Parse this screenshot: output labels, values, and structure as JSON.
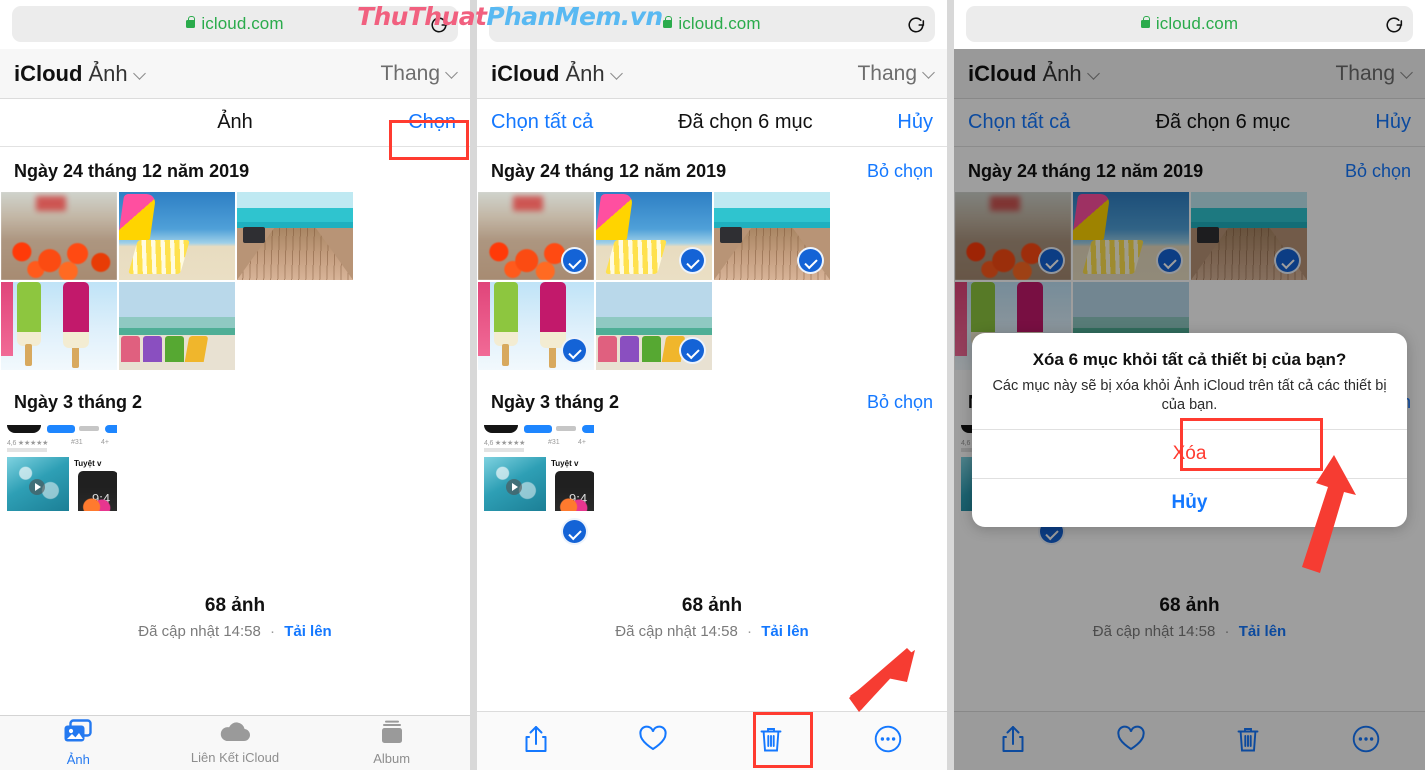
{
  "watermark": {
    "part1": "ThuThuat",
    "part2": "PhanMem.vn"
  },
  "browser": {
    "url": "icloud.com",
    "lock_icon": "lock-icon",
    "reload_icon": "reload-icon"
  },
  "app": {
    "brand_first": "iCloud",
    "brand_second": "Ảnh",
    "scale_label": "Thang"
  },
  "panel1": {
    "action_bar": {
      "center_title": "Ảnh",
      "select_label": "Chọn"
    },
    "sections": [
      {
        "title": "Ngày 24 tháng 12 năm 2019",
        "action": ""
      },
      {
        "title": "Ngày 3 tháng 2",
        "action": ""
      }
    ],
    "footer": {
      "count": "68 ảnh",
      "updated": "Đã cập nhật 14:58",
      "dot": "·",
      "upload": "Tải lên"
    },
    "tabs": [
      {
        "label": "Ảnh",
        "icon": "photos-icon",
        "active": true
      },
      {
        "label": "Liên Kết iCloud",
        "icon": "cloud-icon",
        "active": false
      },
      {
        "label": "Album",
        "icon": "albums-icon",
        "active": false
      }
    ]
  },
  "panel2": {
    "action_bar": {
      "select_all": "Chọn tất cả",
      "selected_count": "Đã chọn 6 mục",
      "cancel": "Hủy"
    },
    "sections": [
      {
        "title": "Ngày 24 tháng 12 năm 2019",
        "action": "Bỏ chọn"
      },
      {
        "title": "Ngày 3 tháng 2",
        "action": "Bỏ chọn"
      }
    ],
    "footer": {
      "count": "68 ảnh",
      "updated": "Đã cập nhật 14:58",
      "dot": "·",
      "upload": "Tải lên"
    },
    "toolbar": [
      {
        "name": "share-icon"
      },
      {
        "name": "heart-icon"
      },
      {
        "name": "trash-icon"
      },
      {
        "name": "more-icon"
      }
    ]
  },
  "panel3": {
    "action_bar": {
      "select_all": "Chọn tất cả",
      "selected_count": "Đã chọn 6 mục",
      "cancel": "Hủy"
    },
    "sections": [
      {
        "title": "Ngày 24 tháng 12 năm 2019",
        "action": "Bỏ chọn"
      },
      {
        "title": "Ngày 3 tháng 2",
        "action": "Bỏ chọn"
      }
    ],
    "footer": {
      "count": "68 ảnh",
      "updated": "Đã cập nhật 14:58",
      "dot": "·",
      "upload": "Tải lên"
    },
    "toolbar": [
      {
        "name": "share-icon"
      },
      {
        "name": "heart-icon"
      },
      {
        "name": "trash-icon"
      },
      {
        "name": "more-icon"
      }
    ],
    "alert": {
      "title": "Xóa 6 mục khỏi tất cả thiết bị của bạn?",
      "message": "Các mục này sẽ bị xóa khỏi Ảnh iCloud trên tất cả các thiết bị của bạn.",
      "confirm": "Xóa",
      "cancel": "Hủy"
    }
  },
  "photos": {
    "group1": [
      "flowers",
      "beach-chair-yellow",
      "wooden-pier",
      "popsicles",
      "beach-chairs-colorful"
    ],
    "group2": [
      "app-store-screenshot"
    ]
  },
  "colors": {
    "accent_blue": "#1478ff",
    "destructive_red": "#ff3b30",
    "secure_green": "#2aab4b",
    "highlight_red": "#ff3b30",
    "checkmark_blue": "#1463d6"
  }
}
